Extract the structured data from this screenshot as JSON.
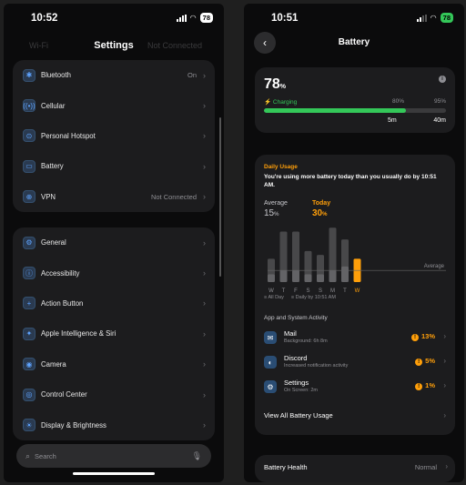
{
  "left": {
    "status": {
      "time": "10:52",
      "battery": "78"
    },
    "nav": {
      "title": "Settings",
      "ghost_left": "Wi-Fi",
      "ghost_right": "Not Connected"
    },
    "group1": [
      {
        "icon": "bluetooth-icon",
        "glyph": "✱",
        "label": "Bluetooth",
        "value": "On"
      },
      {
        "icon": "cellular-icon",
        "glyph": "((•))",
        "label": "Cellular",
        "value": ""
      },
      {
        "icon": "hotspot-icon",
        "glyph": "⊙",
        "label": "Personal Hotspot",
        "value": ""
      },
      {
        "icon": "battery-icon",
        "glyph": "▭",
        "label": "Battery",
        "value": ""
      },
      {
        "icon": "vpn-icon",
        "glyph": "⊕",
        "label": "VPN",
        "value": "Not Connected"
      }
    ],
    "group2": [
      {
        "icon": "general-icon",
        "glyph": "⚙",
        "label": "General"
      },
      {
        "icon": "accessibility-icon",
        "glyph": "ⓘ",
        "label": "Accessibility"
      },
      {
        "icon": "action-button-icon",
        "glyph": "+",
        "label": "Action Button"
      },
      {
        "icon": "siri-icon",
        "glyph": "✦",
        "label": "Apple Intelligence & Siri"
      },
      {
        "icon": "camera-icon",
        "glyph": "◉",
        "label": "Camera"
      },
      {
        "icon": "control-center-icon",
        "glyph": "◎",
        "label": "Control Center"
      },
      {
        "icon": "display-icon",
        "glyph": "☀",
        "label": "Display & Brightness"
      }
    ],
    "search": {
      "placeholder": "Search"
    }
  },
  "right": {
    "status": {
      "time": "10:51",
      "battery": "78"
    },
    "nav": {
      "title": "Battery"
    },
    "level": {
      "value": "78",
      "unit": "%",
      "charging": "Charging",
      "m80": "80%",
      "m95": "95%",
      "t80": "5m",
      "t95": "40m",
      "fill_fraction": 0.78
    },
    "daily": {
      "title": "Daily Usage",
      "text": "You're using more battery today than you usually do by 10:51 AM.",
      "avg_label": "Average",
      "avg_value": "15",
      "today_label": "Today",
      "today_value": "30",
      "unit": "%",
      "legend_all": "All Day",
      "legend_by": "Daily by 10:51 AM",
      "average_line_label": "Average"
    },
    "activity": {
      "title": "App and System Activity",
      "apps": [
        {
          "icon": "mail-icon",
          "glyph": "✉",
          "name": "Mail",
          "sub": "Background: 6h 8m",
          "pct": "13%"
        },
        {
          "icon": "discord-icon",
          "glyph": "◐",
          "name": "Discord",
          "sub": "Increased notification activity",
          "pct": "5%"
        },
        {
          "icon": "settings-app-icon",
          "glyph": "⚙",
          "name": "Settings",
          "sub": "On Screen: 2m",
          "pct": "1%"
        }
      ],
      "view_all": "View All Battery Usage"
    },
    "health": {
      "label": "Battery Health",
      "value": "Normal"
    }
  },
  "chart_data": {
    "type": "bar",
    "categories": [
      "W",
      "T",
      "F",
      "S",
      "S",
      "M",
      "T",
      "W"
    ],
    "series": [
      {
        "name": "All Day",
        "values": [
          30,
          65,
          65,
          40,
          35,
          70,
          55,
          0
        ]
      },
      {
        "name": "Daily by 10:51 AM",
        "values": [
          10,
          15,
          15,
          10,
          10,
          15,
          20,
          30
        ]
      }
    ],
    "average": 15,
    "ylim": [
      0,
      75
    ],
    "colors": {
      "all_day": "#48484a",
      "by_time": "#636366",
      "today": "#ff9f0a",
      "average_line": "#636366"
    }
  }
}
